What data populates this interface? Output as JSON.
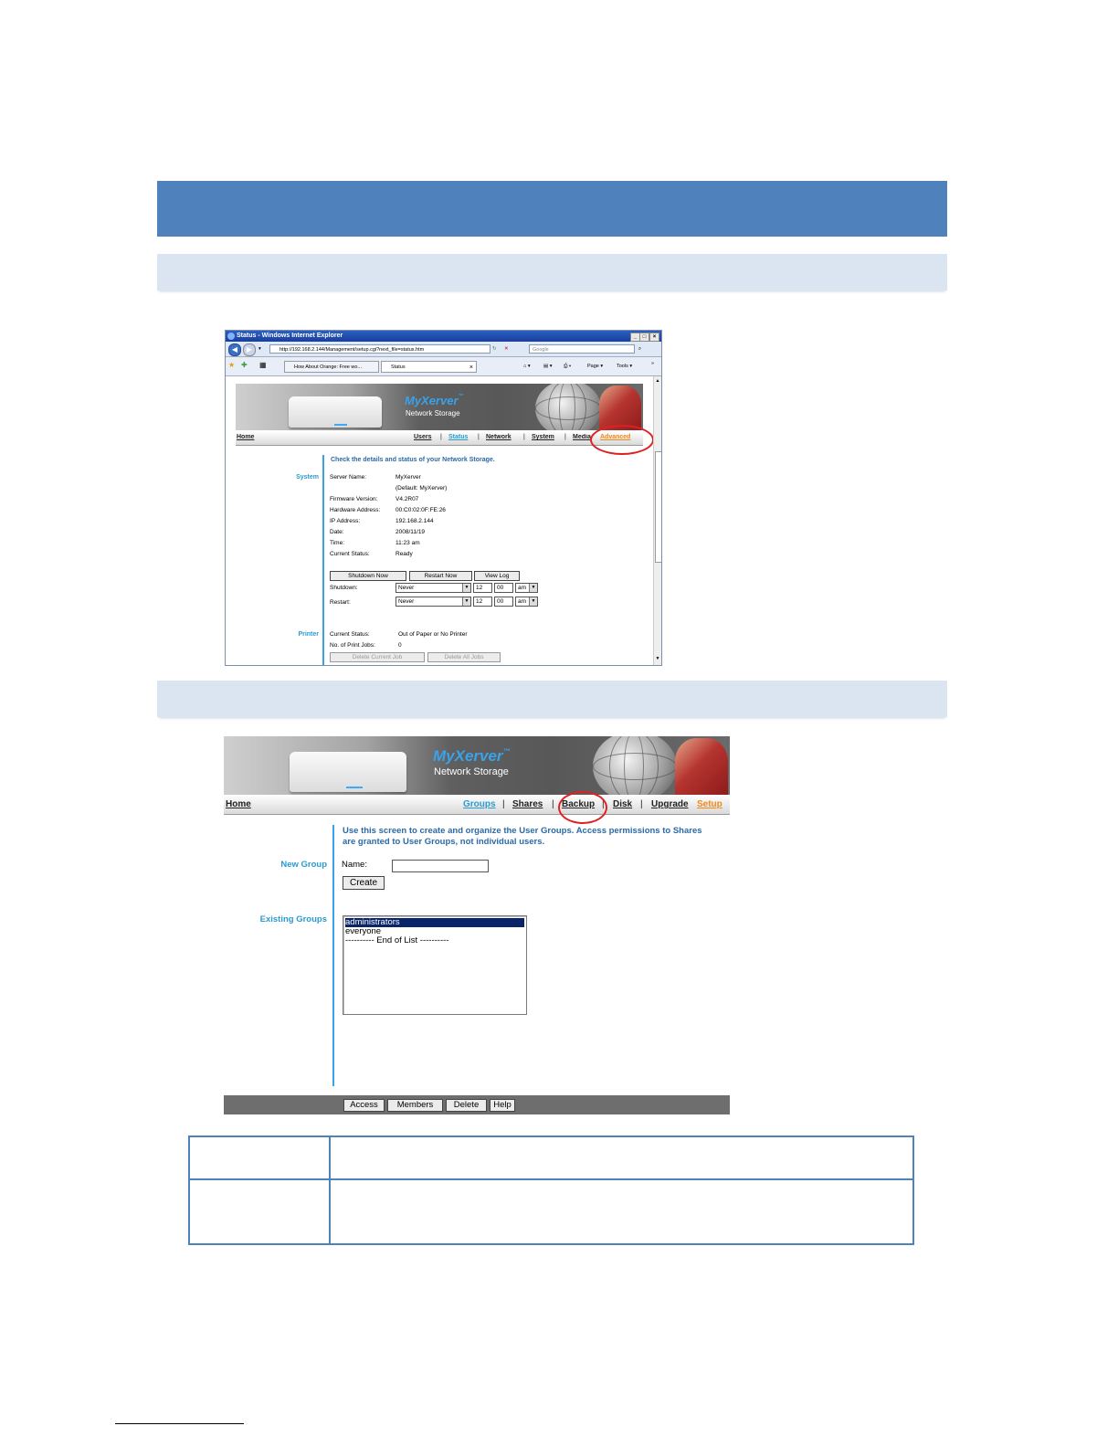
{
  "doc": {
    "screenshot1": {
      "window_title": "Status - Windows Internet Explorer",
      "window_buttons": [
        "_",
        "□",
        "×"
      ],
      "url": "http://192.168.2.144/Management/setup.cgi?next_file=status.htm",
      "search_placeholder": "Google",
      "tabs": [
        {
          "label": "How About Orange: Free wo..."
        },
        {
          "label": "Status"
        }
      ],
      "tab_close": "×",
      "toolbar": {
        "home": "⌂ ▾",
        "feeds": "▤ ▾",
        "print": "⎙ ▾",
        "page": "Page ▾",
        "tools": "Tools ▾",
        "more": "»"
      },
      "logo": "MyXerver",
      "logo_tm": "™",
      "logo_sub": "Network Storage",
      "nav": {
        "home": "Home",
        "users": "Users",
        "status": "Status",
        "network": "Network",
        "system": "System",
        "media": "Media",
        "advanced": "Advanced",
        "sep": "|"
      },
      "intro": "Check the details and status of your Network Storage.",
      "system_label": "System",
      "fields": [
        {
          "label": "Server Name:",
          "value": "MyXerver"
        },
        {
          "label": "",
          "value": "(Default: MyXerver)"
        },
        {
          "label": "Firmware Version:",
          "value": "V4.2R07"
        },
        {
          "label": "Hardware Address:",
          "value": "00:C0:02:0F:FE:26"
        },
        {
          "label": "IP Address:",
          "value": "192.168.2.144"
        },
        {
          "label": "Date:",
          "value": "2008/11/19"
        },
        {
          "label": "Time:",
          "value": "11:23 am"
        },
        {
          "label": "Current Status:",
          "value": "Ready"
        }
      ],
      "buttons": {
        "shutdown_now": "Shutdown Now",
        "restart_now": "Restart Now",
        "view_log": "View Log"
      },
      "shutdown": {
        "label": "Shutdown:",
        "select": "Never",
        "hour": "12",
        "minute": "00",
        "ampm": "am"
      },
      "restart": {
        "label": "Restart:",
        "select": "Never",
        "hour": "12",
        "minute": "00",
        "ampm": "am"
      },
      "printer_label": "Printer",
      "printer_fields": [
        {
          "label": "Current Status:",
          "value": "Out of Paper or No Printer"
        },
        {
          "label": "No. of Print Jobs:",
          "value": "0"
        }
      ],
      "printer_buttons": {
        "delete_current": "Delete Current Job",
        "delete_all": "Delete All Jobs"
      }
    },
    "screenshot2": {
      "logo": "MyXerver",
      "logo_tm": "™",
      "logo_sub": "Network Storage",
      "nav": {
        "home": "Home",
        "groups": "Groups",
        "shares": "Shares",
        "backup": "Backup",
        "disk": "Disk",
        "upgrade": "Upgrade",
        "setup": "Setup",
        "sep": "|"
      },
      "intro_line1": "Use this screen to create and organize the User Groups. Access permissions to Shares",
      "intro_line2": "are granted to User Groups, not individual users.",
      "new_group_label": "New Group",
      "name_label": "Name:",
      "name_value": "",
      "create_button": "Create",
      "existing_groups_label": "Existing Groups",
      "groups": [
        "administrators",
        "everyone",
        "---------- End of List ----------"
      ],
      "footer_buttons": {
        "access": "Access",
        "members": "Members",
        "delete": "Delete",
        "help": "Help"
      }
    }
  }
}
